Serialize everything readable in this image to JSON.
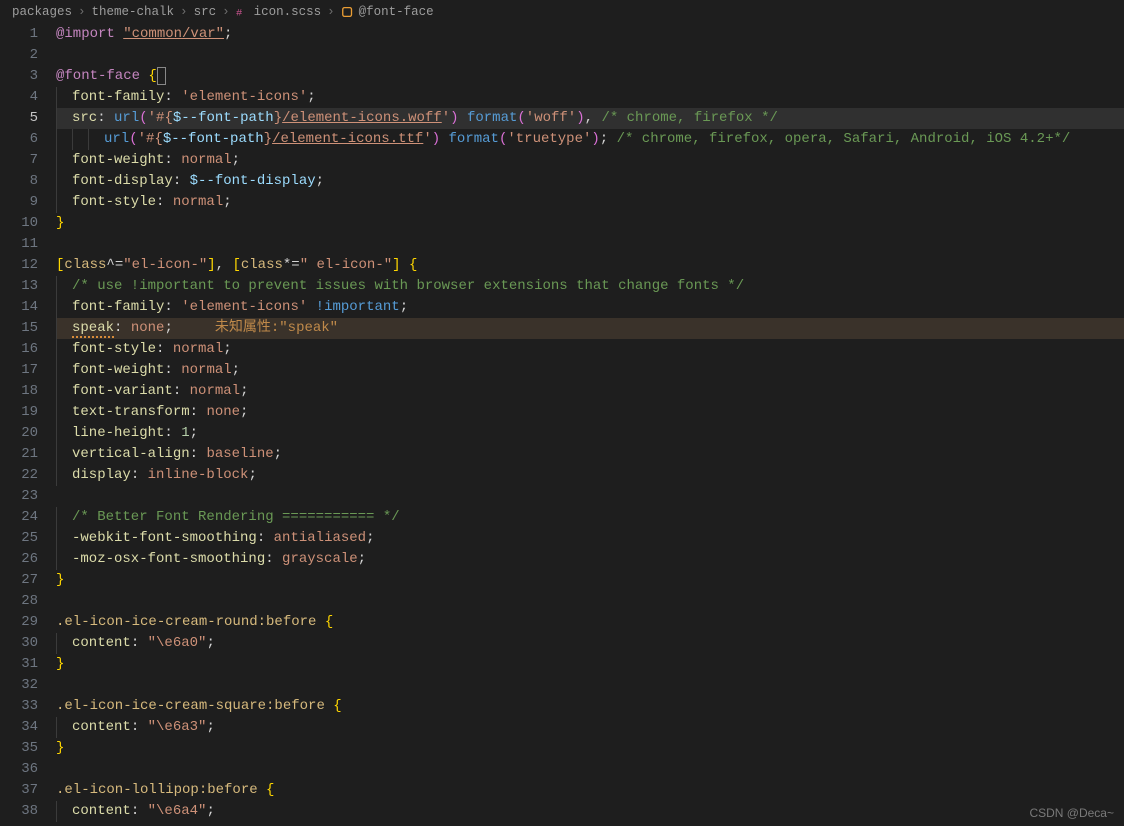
{
  "breadcrumb": {
    "items": [
      "packages",
      "theme-chalk",
      "src",
      "icon.scss",
      "@font-face"
    ],
    "file_icon_color": "#c6538c",
    "symbol_icon_color": "#ea9d34"
  },
  "active_line": 5,
  "warn_line": 15,
  "warn_text": "未知属性:\"speak\"",
  "cursor": {
    "line": 3,
    "after_text": "@font-face {"
  },
  "watermark": "CSDN @Deca~",
  "code": [
    {
      "n": 1,
      "indent": 0,
      "tokens": [
        [
          "c-at",
          "@import"
        ],
        [
          "c-punc",
          " "
        ],
        [
          "c-url",
          "\"common/var\""
        ],
        [
          "c-punc",
          ";"
        ]
      ]
    },
    {
      "n": 2,
      "indent": 0,
      "tokens": []
    },
    {
      "n": 3,
      "indent": 0,
      "tokens": [
        [
          "c-at",
          "@font-face"
        ],
        [
          "c-punc",
          " "
        ],
        [
          "c-brace",
          "{"
        ]
      ],
      "cursor_after": true
    },
    {
      "n": 4,
      "indent": 1,
      "tokens": [
        [
          "c-key",
          "font-family"
        ],
        [
          "c-punc",
          ": "
        ],
        [
          "c-str",
          "'element-icons'"
        ],
        [
          "c-punc",
          ";"
        ]
      ]
    },
    {
      "n": 5,
      "indent": 1,
      "tokens": [
        [
          "c-key",
          "src"
        ],
        [
          "c-punc",
          ": "
        ],
        [
          "c-fn",
          "url"
        ],
        [
          "c-brace2",
          "("
        ],
        [
          "c-str",
          "'#{"
        ],
        [
          "c-ident",
          "$--font-path"
        ],
        [
          "c-str",
          "}"
        ],
        [
          "c-url",
          "/element-icons.woff"
        ],
        [
          "c-str",
          "'"
        ],
        [
          "c-brace2",
          ")"
        ],
        [
          "c-punc",
          " "
        ],
        [
          "c-fn",
          "format"
        ],
        [
          "c-brace2",
          "("
        ],
        [
          "c-str",
          "'woff'"
        ],
        [
          "c-brace2",
          ")"
        ],
        [
          "c-punc",
          ", "
        ],
        [
          "c-cmt",
          "/* chrome, firefox */"
        ]
      ]
    },
    {
      "n": 6,
      "indent": 3,
      "tokens": [
        [
          "c-fn",
          "url"
        ],
        [
          "c-brace2",
          "("
        ],
        [
          "c-str",
          "'#{"
        ],
        [
          "c-ident",
          "$--font-path"
        ],
        [
          "c-str",
          "}"
        ],
        [
          "c-url",
          "/element-icons.ttf"
        ],
        [
          "c-str",
          "'"
        ],
        [
          "c-brace2",
          ")"
        ],
        [
          "c-punc",
          " "
        ],
        [
          "c-fn",
          "format"
        ],
        [
          "c-brace2",
          "("
        ],
        [
          "c-str",
          "'truetype'"
        ],
        [
          "c-brace2",
          ")"
        ],
        [
          "c-punc",
          "; "
        ],
        [
          "c-cmt",
          "/* chrome, firefox, opera, Safari, Android, iOS 4.2+*/"
        ]
      ]
    },
    {
      "n": 7,
      "indent": 1,
      "tokens": [
        [
          "c-key",
          "font-weight"
        ],
        [
          "c-punc",
          ": "
        ],
        [
          "c-val",
          "normal"
        ],
        [
          "c-punc",
          ";"
        ]
      ]
    },
    {
      "n": 8,
      "indent": 1,
      "tokens": [
        [
          "c-key",
          "font-display"
        ],
        [
          "c-punc",
          ": "
        ],
        [
          "c-ident",
          "$--font-display"
        ],
        [
          "c-punc",
          ";"
        ]
      ]
    },
    {
      "n": 9,
      "indent": 1,
      "tokens": [
        [
          "c-key",
          "font-style"
        ],
        [
          "c-punc",
          ": "
        ],
        [
          "c-val",
          "normal"
        ],
        [
          "c-punc",
          ";"
        ]
      ]
    },
    {
      "n": 10,
      "indent": 0,
      "tokens": [
        [
          "c-brace",
          "}"
        ]
      ]
    },
    {
      "n": 11,
      "indent": 0,
      "tokens": []
    },
    {
      "n": 12,
      "indent": 0,
      "tokens": [
        [
          "c-brace",
          "["
        ],
        [
          "c-sel",
          "class"
        ],
        [
          "c-punc",
          "^="
        ],
        [
          "c-str",
          "\"el-icon-\""
        ],
        [
          "c-brace",
          "]"
        ],
        [
          "c-punc",
          ", "
        ],
        [
          "c-brace",
          "["
        ],
        [
          "c-sel",
          "class"
        ],
        [
          "c-punc",
          "*="
        ],
        [
          "c-str",
          "\" el-icon-\""
        ],
        [
          "c-brace",
          "]"
        ],
        [
          "c-punc",
          " "
        ],
        [
          "c-brace",
          "{"
        ]
      ]
    },
    {
      "n": 13,
      "indent": 1,
      "tokens": [
        [
          "c-cmt",
          "/* use !important to prevent issues with browser extensions that change fonts */"
        ]
      ]
    },
    {
      "n": 14,
      "indent": 1,
      "tokens": [
        [
          "c-key",
          "font-family"
        ],
        [
          "c-punc",
          ": "
        ],
        [
          "c-str",
          "'element-icons'"
        ],
        [
          "c-punc",
          " "
        ],
        [
          "c-kw2",
          "!important"
        ],
        [
          "c-punc",
          ";"
        ]
      ]
    },
    {
      "n": 15,
      "indent": 1,
      "tokens": [
        [
          "c-key squiggle",
          "speak"
        ],
        [
          "c-punc",
          ": "
        ],
        [
          "c-val",
          "none"
        ],
        [
          "c-punc",
          ";     "
        ],
        [
          "c-warn",
          "未知属性:\"speak\""
        ]
      ]
    },
    {
      "n": 16,
      "indent": 1,
      "tokens": [
        [
          "c-key",
          "font-style"
        ],
        [
          "c-punc",
          ": "
        ],
        [
          "c-val",
          "normal"
        ],
        [
          "c-punc",
          ";"
        ]
      ]
    },
    {
      "n": 17,
      "indent": 1,
      "tokens": [
        [
          "c-key",
          "font-weight"
        ],
        [
          "c-punc",
          ": "
        ],
        [
          "c-val",
          "normal"
        ],
        [
          "c-punc",
          ";"
        ]
      ]
    },
    {
      "n": 18,
      "indent": 1,
      "tokens": [
        [
          "c-key",
          "font-variant"
        ],
        [
          "c-punc",
          ": "
        ],
        [
          "c-val",
          "normal"
        ],
        [
          "c-punc",
          ";"
        ]
      ]
    },
    {
      "n": 19,
      "indent": 1,
      "tokens": [
        [
          "c-key",
          "text-transform"
        ],
        [
          "c-punc",
          ": "
        ],
        [
          "c-val",
          "none"
        ],
        [
          "c-punc",
          ";"
        ]
      ]
    },
    {
      "n": 20,
      "indent": 1,
      "tokens": [
        [
          "c-key",
          "line-height"
        ],
        [
          "c-punc",
          ": "
        ],
        [
          "c-num",
          "1"
        ],
        [
          "c-punc",
          ";"
        ]
      ]
    },
    {
      "n": 21,
      "indent": 1,
      "tokens": [
        [
          "c-key",
          "vertical-align"
        ],
        [
          "c-punc",
          ": "
        ],
        [
          "c-val",
          "baseline"
        ],
        [
          "c-punc",
          ";"
        ]
      ]
    },
    {
      "n": 22,
      "indent": 1,
      "tokens": [
        [
          "c-key",
          "display"
        ],
        [
          "c-punc",
          ": "
        ],
        [
          "c-val",
          "inline-block"
        ],
        [
          "c-punc",
          ";"
        ]
      ]
    },
    {
      "n": 23,
      "indent": 0,
      "tokens": []
    },
    {
      "n": 24,
      "indent": 1,
      "tokens": [
        [
          "c-cmt",
          "/* Better Font Rendering =========== */"
        ]
      ]
    },
    {
      "n": 25,
      "indent": 1,
      "tokens": [
        [
          "c-key",
          "-webkit-font-smoothing"
        ],
        [
          "c-punc",
          ": "
        ],
        [
          "c-val",
          "antialiased"
        ],
        [
          "c-punc",
          ";"
        ]
      ]
    },
    {
      "n": 26,
      "indent": 1,
      "tokens": [
        [
          "c-key",
          "-moz-osx-font-smoothing"
        ],
        [
          "c-punc",
          ": "
        ],
        [
          "c-val",
          "grayscale"
        ],
        [
          "c-punc",
          ";"
        ]
      ]
    },
    {
      "n": 27,
      "indent": 0,
      "tokens": [
        [
          "c-brace",
          "}"
        ]
      ]
    },
    {
      "n": 28,
      "indent": 0,
      "tokens": []
    },
    {
      "n": 29,
      "indent": 0,
      "tokens": [
        [
          "c-sel",
          ".el-icon-ice-cream-round:before"
        ],
        [
          "c-punc",
          " "
        ],
        [
          "c-brace",
          "{"
        ]
      ]
    },
    {
      "n": 30,
      "indent": 1,
      "tokens": [
        [
          "c-key",
          "content"
        ],
        [
          "c-punc",
          ": "
        ],
        [
          "c-str",
          "\"\\e6a0\""
        ],
        [
          "c-punc",
          ";"
        ]
      ]
    },
    {
      "n": 31,
      "indent": 0,
      "tokens": [
        [
          "c-brace",
          "}"
        ]
      ]
    },
    {
      "n": 32,
      "indent": 0,
      "tokens": []
    },
    {
      "n": 33,
      "indent": 0,
      "tokens": [
        [
          "c-sel",
          ".el-icon-ice-cream-square:before"
        ],
        [
          "c-punc",
          " "
        ],
        [
          "c-brace",
          "{"
        ]
      ]
    },
    {
      "n": 34,
      "indent": 1,
      "tokens": [
        [
          "c-key",
          "content"
        ],
        [
          "c-punc",
          ": "
        ],
        [
          "c-str",
          "\"\\e6a3\""
        ],
        [
          "c-punc",
          ";"
        ]
      ]
    },
    {
      "n": 35,
      "indent": 0,
      "tokens": [
        [
          "c-brace",
          "}"
        ]
      ]
    },
    {
      "n": 36,
      "indent": 0,
      "tokens": []
    },
    {
      "n": 37,
      "indent": 0,
      "tokens": [
        [
          "c-sel",
          ".el-icon-lollipop:before"
        ],
        [
          "c-punc",
          " "
        ],
        [
          "c-brace",
          "{"
        ]
      ]
    },
    {
      "n": 38,
      "indent": 1,
      "tokens": [
        [
          "c-key",
          "content"
        ],
        [
          "c-punc",
          ": "
        ],
        [
          "c-str",
          "\"\\e6a4\""
        ],
        [
          "c-punc",
          ";"
        ]
      ]
    }
  ]
}
